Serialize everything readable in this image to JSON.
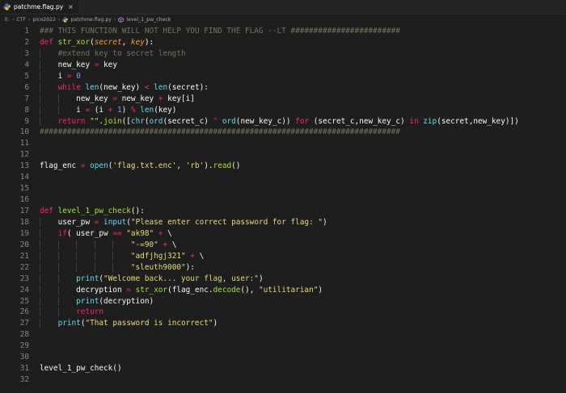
{
  "tab": {
    "filename": "patchme.flag.py",
    "close_glyph": "×",
    "icon": "python-file-icon"
  },
  "breadcrumb": [
    "E:",
    "CTF",
    "pico2022",
    "patchme.flag.py",
    "level_1_pw_check"
  ],
  "breadcrumb_separator": "›",
  "colors": {
    "background": "#1e1e1e",
    "keyword": "#f92672",
    "function": "#a6e22e",
    "parameter": "#fd971f",
    "string": "#e6db74",
    "number": "#ae81ff",
    "comment": "#75715e",
    "builtin": "#66d9ef",
    "text": "#f8f8f2",
    "line_number": "#858585"
  },
  "editor": {
    "lines": [
      {
        "n": "1",
        "indent": 0,
        "tokens": [
          [
            "cmt",
            "### THIS FUNCTION WILL NOT HELP YOU FIND THE FLAG --LT ########################"
          ]
        ]
      },
      {
        "n": "2",
        "indent": 0,
        "tokens": [
          [
            "kw",
            "def "
          ],
          [
            "fn",
            "str_xor"
          ],
          [
            "txt",
            "("
          ],
          [
            "param",
            "secret"
          ],
          [
            "txt",
            ", "
          ],
          [
            "param",
            "key"
          ],
          [
            "txt",
            "):"
          ]
        ]
      },
      {
        "n": "3",
        "indent": 1,
        "tokens": [
          [
            "cmt",
            "#extend key to secret length"
          ]
        ]
      },
      {
        "n": "4",
        "indent": 1,
        "tokens": [
          [
            "txt",
            "new_key "
          ],
          [
            "op",
            "="
          ],
          [
            "txt",
            " key"
          ]
        ]
      },
      {
        "n": "5",
        "indent": 1,
        "tokens": [
          [
            "txt",
            "i "
          ],
          [
            "op",
            "="
          ],
          [
            "txt",
            " "
          ],
          [
            "num",
            "0"
          ]
        ]
      },
      {
        "n": "6",
        "indent": 1,
        "tokens": [
          [
            "kw",
            "while "
          ],
          [
            "bi",
            "len"
          ],
          [
            "txt",
            "(new_key) "
          ],
          [
            "op",
            "<"
          ],
          [
            "txt",
            " "
          ],
          [
            "bi",
            "len"
          ],
          [
            "txt",
            "(secret):"
          ]
        ]
      },
      {
        "n": "7",
        "indent": 2,
        "tokens": [
          [
            "txt",
            "new_key "
          ],
          [
            "op",
            "="
          ],
          [
            "txt",
            " new_key "
          ],
          [
            "op",
            "+"
          ],
          [
            "txt",
            " key[i]"
          ]
        ]
      },
      {
        "n": "8",
        "indent": 2,
        "tokens": [
          [
            "txt",
            "i "
          ],
          [
            "op",
            "="
          ],
          [
            "txt",
            " (i "
          ],
          [
            "op",
            "+"
          ],
          [
            "txt",
            " "
          ],
          [
            "num",
            "1"
          ],
          [
            "txt",
            ") "
          ],
          [
            "op",
            "%"
          ],
          [
            "txt",
            " "
          ],
          [
            "bi",
            "len"
          ],
          [
            "txt",
            "(key)"
          ]
        ]
      },
      {
        "n": "9",
        "indent": 1,
        "tokens": [
          [
            "kw",
            "return "
          ],
          [
            "str",
            "\"\""
          ],
          [
            "txt",
            "."
          ],
          [
            "fn",
            "join"
          ],
          [
            "txt",
            "(["
          ],
          [
            "bi",
            "chr"
          ],
          [
            "txt",
            "("
          ],
          [
            "bi",
            "ord"
          ],
          [
            "txt",
            "(secret_c) "
          ],
          [
            "op",
            "^"
          ],
          [
            "txt",
            " "
          ],
          [
            "bi",
            "ord"
          ],
          [
            "txt",
            "(new_key_c)) "
          ],
          [
            "kw",
            "for"
          ],
          [
            "txt",
            " (secret_c,new_key_c) "
          ],
          [
            "kw",
            "in"
          ],
          [
            "txt",
            " "
          ],
          [
            "bi",
            "zip"
          ],
          [
            "txt",
            "(secret,new_key)])"
          ]
        ]
      },
      {
        "n": "10",
        "indent": 0,
        "tokens": [
          [
            "cmt",
            "###############################################################################"
          ]
        ]
      },
      {
        "n": "11",
        "indent": 0,
        "tokens": []
      },
      {
        "n": "12",
        "indent": 0,
        "tokens": []
      },
      {
        "n": "13",
        "indent": 0,
        "tokens": [
          [
            "txt",
            "flag_enc "
          ],
          [
            "op",
            "="
          ],
          [
            "txt",
            " "
          ],
          [
            "bi",
            "open"
          ],
          [
            "txt",
            "("
          ],
          [
            "str",
            "'flag.txt.enc'"
          ],
          [
            "txt",
            ", "
          ],
          [
            "str",
            "'rb'"
          ],
          [
            "txt",
            ")."
          ],
          [
            "fn",
            "read"
          ],
          [
            "txt",
            "()"
          ]
        ]
      },
      {
        "n": "14",
        "indent": 0,
        "tokens": []
      },
      {
        "n": "15",
        "indent": 0,
        "tokens": []
      },
      {
        "n": "16",
        "indent": 0,
        "tokens": []
      },
      {
        "n": "17",
        "indent": 0,
        "tokens": [
          [
            "kw",
            "def "
          ],
          [
            "fn",
            "level_1_pw_check"
          ],
          [
            "txt",
            "():"
          ]
        ]
      },
      {
        "n": "18",
        "indent": 1,
        "tokens": [
          [
            "txt",
            "user_pw "
          ],
          [
            "op",
            "="
          ],
          [
            "txt",
            " "
          ],
          [
            "bi",
            "input"
          ],
          [
            "txt",
            "("
          ],
          [
            "str",
            "\"Please enter correct password for flag: \""
          ],
          [
            "txt",
            ")"
          ]
        ]
      },
      {
        "n": "19",
        "indent": 1,
        "tokens": [
          [
            "kw",
            "if"
          ],
          [
            "txt",
            "( user_pw "
          ],
          [
            "op",
            "=="
          ],
          [
            "txt",
            " "
          ],
          [
            "str",
            "\"ak98\""
          ],
          [
            "txt",
            " "
          ],
          [
            "op",
            "+"
          ],
          [
            "txt",
            " \\"
          ]
        ]
      },
      {
        "n": "20",
        "indent": 5,
        "tokens": [
          [
            "str",
            "\"-=90\""
          ],
          [
            "txt",
            " "
          ],
          [
            "op",
            "+"
          ],
          [
            "txt",
            " \\"
          ]
        ]
      },
      {
        "n": "21",
        "indent": 5,
        "tokens": [
          [
            "str",
            "\"adfjhgj321\""
          ],
          [
            "txt",
            " "
          ],
          [
            "op",
            "+"
          ],
          [
            "txt",
            " \\"
          ]
        ]
      },
      {
        "n": "22",
        "indent": 5,
        "tokens": [
          [
            "str",
            "\"sleuth9000\""
          ],
          [
            "txt",
            "):"
          ]
        ]
      },
      {
        "n": "23",
        "indent": 2,
        "tokens": [
          [
            "bi",
            "print"
          ],
          [
            "txt",
            "("
          ],
          [
            "str",
            "\"Welcome back... your flag, user:\""
          ],
          [
            "txt",
            ")"
          ]
        ]
      },
      {
        "n": "24",
        "indent": 2,
        "tokens": [
          [
            "txt",
            "decryption "
          ],
          [
            "op",
            "="
          ],
          [
            "txt",
            " "
          ],
          [
            "fn",
            "str_xor"
          ],
          [
            "txt",
            "(flag_enc."
          ],
          [
            "fn",
            "decode"
          ],
          [
            "txt",
            "(), "
          ],
          [
            "str",
            "\"utilitarian\""
          ],
          [
            "txt",
            ")"
          ]
        ]
      },
      {
        "n": "25",
        "indent": 2,
        "tokens": [
          [
            "bi",
            "print"
          ],
          [
            "txt",
            "(decryption)"
          ]
        ]
      },
      {
        "n": "26",
        "indent": 2,
        "tokens": [
          [
            "kw",
            "return"
          ]
        ]
      },
      {
        "n": "27",
        "indent": 1,
        "tokens": [
          [
            "bi",
            "print"
          ],
          [
            "txt",
            "("
          ],
          [
            "str",
            "\"That password is incorrect\""
          ],
          [
            "txt",
            ")"
          ]
        ]
      },
      {
        "n": "28",
        "indent": 0,
        "tokens": []
      },
      {
        "n": "29",
        "indent": 0,
        "tokens": []
      },
      {
        "n": "30",
        "indent": 0,
        "tokens": []
      },
      {
        "n": "31",
        "indent": 0,
        "tokens": [
          [
            "txt",
            "level_1_pw_check()"
          ]
        ]
      },
      {
        "n": "32",
        "indent": 0,
        "tokens": []
      }
    ]
  }
}
